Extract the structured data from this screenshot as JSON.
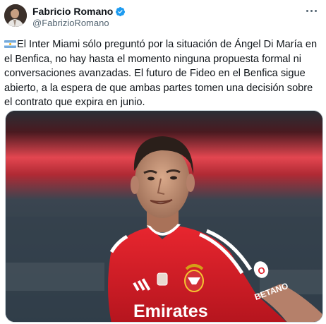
{
  "author": {
    "name": "Fabricio Romano",
    "handle": "@FabrizioRomano",
    "verified": true,
    "avatar_icon": "profile-photo"
  },
  "tweet": {
    "flag_icon": "argentina-flag-icon",
    "text": "El Inter Miami sólo preguntó por la situación de Ángel Di María en el Benfica, no hay hasta el momento ninguna propuesta formal ni conversaciones avanzadas. El futuro de Fideo en el Benfica sigue abierto, a la espera de que ambas partes tomen una decisión sobre el contrato que expira en junio."
  },
  "media": {
    "jersey_sponsor": "Emirates",
    "jersey_sleeve": "BETANO",
    "kit_brand_icon": "adidas-logo",
    "crest_icon": "benfica-crest"
  },
  "colors": {
    "verified_blue": "#1d9bf0",
    "text": "#0f1419",
    "secondary_text": "#536471",
    "jersey_red": "#e0212a"
  }
}
